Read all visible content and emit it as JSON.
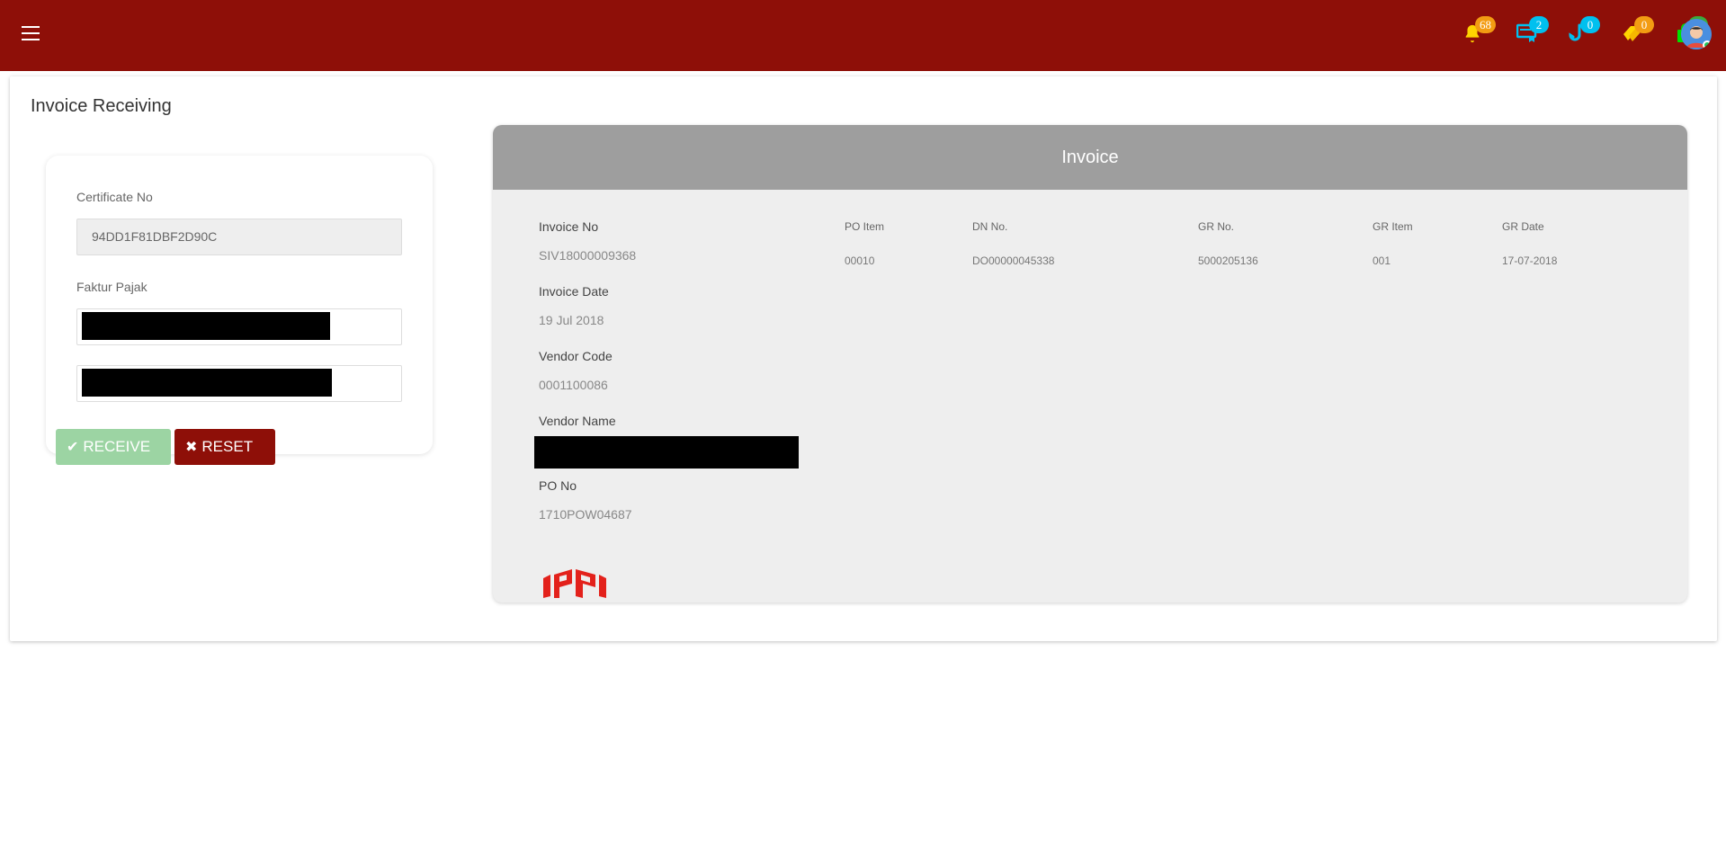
{
  "header": {
    "badges": [
      {
        "icon": "bell-icon",
        "count": "68",
        "icon_color": "#ffd400",
        "badge_color": "#f39c12"
      },
      {
        "icon": "certificate-icon",
        "count": "2",
        "icon_color": "#00c0ef",
        "badge_color": "#00c0ef"
      },
      {
        "icon": "hook-icon",
        "count": "0",
        "icon_color": "#00c0ef",
        "badge_color": "#00c0ef"
      },
      {
        "icon": "tags-icon",
        "count": "0",
        "icon_color": "#ffd400",
        "badge_color": "#f39c12"
      },
      {
        "icon": "shopping-bag-icon",
        "count": "0",
        "icon_color": "#00e000",
        "badge_color": "#3cab3c"
      }
    ]
  },
  "page": {
    "title": "Invoice Receiving"
  },
  "form": {
    "certificate_label": "Certificate No",
    "certificate_value": "94DD1F81DBF2D90C",
    "faktur_label": "Faktur Pajak"
  },
  "actions": {
    "receive_label": "RECEIVE",
    "reset_label": "RESET"
  },
  "invoice": {
    "header": "Invoice",
    "fields": {
      "invoice_no_label": "Invoice No",
      "invoice_no": "SIV18000009368",
      "invoice_date_label": "Invoice Date",
      "invoice_date": "19 Jul 2018",
      "vendor_code_label": "Vendor Code",
      "vendor_code": "0001100086",
      "vendor_name_label": "Vendor Name",
      "po_no_label": "PO No",
      "po_no": "1710POW04687"
    },
    "table": {
      "columns": [
        "PO Item",
        "DN No.",
        "GR No.",
        "GR Item",
        "GR Date"
      ],
      "row": [
        "00010",
        "DO00000045338",
        "5000205136",
        "001",
        "17-07-2018"
      ]
    }
  },
  "colors": {
    "brand": "#8e0f08",
    "receive_button": "#9cd4a3",
    "logo": "#e3211b"
  }
}
